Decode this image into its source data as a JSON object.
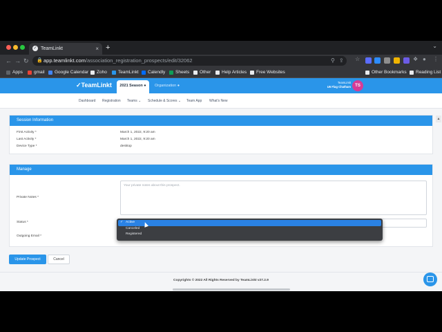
{
  "browser": {
    "tab_title": "TeamLinkt",
    "tab_close": "×",
    "new_tab": "+",
    "tab_chevron": "⌄",
    "url_host": "app.teamlinkt.com",
    "url_path": "/association_registration_prospects/edit/32062",
    "nav": {
      "back": "←",
      "forward": "→",
      "reload": "↻"
    },
    "bookmarks": [
      {
        "label": "Apps",
        "color": "#5f6368"
      },
      {
        "label": "gmail",
        "color": "#ea4335"
      },
      {
        "label": "Google Calendar",
        "color": "#4285f4"
      },
      {
        "label": "Zoho",
        "color": "#e8eaed"
      },
      {
        "label": "TeamLinkt",
        "color": "#2a95e9"
      },
      {
        "label": "Calendly",
        "color": "#006bff"
      },
      {
        "label": "Sheets",
        "color": "#0f9d58"
      },
      {
        "label": "Other",
        "color": "#e8eaed"
      },
      {
        "label": "Help Articles",
        "color": "#e8eaed"
      },
      {
        "label": "Free Websites",
        "color": "#e8eaed"
      }
    ],
    "other_bookmarks": "Other Bookmarks",
    "reading_list": "Reading List"
  },
  "site": {
    "logo_text": "TeamLinkt",
    "season_tab": "2021 Season",
    "org_tab": "Organization",
    "user_role": "TeamLinkt",
    "user_name": "U6 Flag Chatham",
    "avatar_initials": "TS",
    "nav": [
      "Dashboard",
      "Registration",
      "Teams",
      "Schedule & Scores",
      "Team App",
      "What's New"
    ],
    "nav_has_caret": [
      false,
      false,
      true,
      true,
      false,
      false
    ]
  },
  "session": {
    "heading": "Session Information",
    "rows": [
      {
        "label": "First Activity *",
        "value": "March 1, 2022, 9:20 am"
      },
      {
        "label": "Last Activity *",
        "value": "March 1, 2022, 9:20 am"
      },
      {
        "label": "Device Type *",
        "value": "desktop"
      }
    ]
  },
  "manage": {
    "heading": "Manage",
    "private_notes_label": "Private Notes *",
    "private_notes_placeholder": "Your private notes about this prospect.",
    "status_label": "Status *",
    "outgoing_email_label": "Outgoing Email *",
    "status_options": [
      "Active",
      "Canceled",
      "Registered"
    ],
    "status_selected": "Active",
    "check_glyph": "✓"
  },
  "actions": {
    "update_label": "Update Prospect",
    "cancel_label": "Cancel"
  },
  "footer": {
    "text": "Copyrights © 2022 All Rights Reserved by TeamLinkt v27.2.9"
  },
  "colors": {
    "brand": "#2a95e9",
    "avatar": "#d63b96"
  }
}
